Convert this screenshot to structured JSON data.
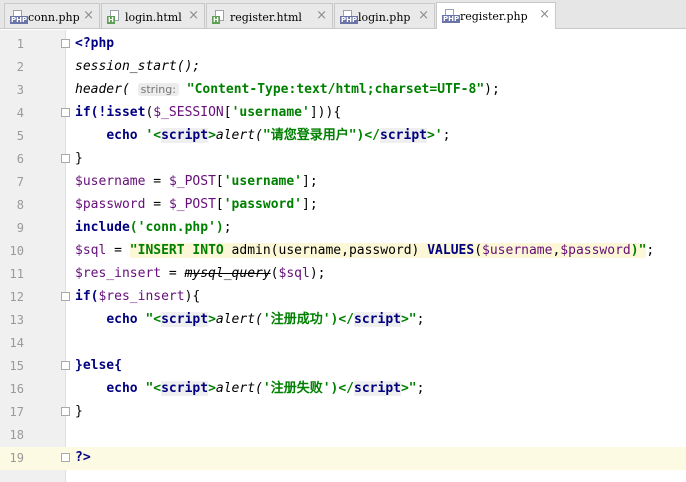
{
  "tabs": [
    {
      "label": "conn.php",
      "type": "php",
      "badge": "PHP",
      "active": false
    },
    {
      "label": "login.html",
      "type": "html",
      "badge": "H",
      "active": false
    },
    {
      "label": "register.html",
      "type": "html",
      "badge": "H",
      "active": false
    },
    {
      "label": "login.php",
      "type": "php",
      "badge": "PHP",
      "active": false
    },
    {
      "label": "register.php",
      "type": "php",
      "badge": "PHP",
      "active": true
    }
  ],
  "close_glyph": "×",
  "line_numbers": [
    "1",
    "2",
    "3",
    "4",
    "5",
    "6",
    "7",
    "8",
    "9",
    "10",
    "11",
    "12",
    "13",
    "14",
    "15",
    "16",
    "17",
    "18",
    "19"
  ],
  "code": {
    "l1": "<?php",
    "l2": "session_start();",
    "l3_fn": "header(",
    "l3_hint": "string:",
    "l3_str": "\"Content-Type:text/html;charset=UTF-8\"",
    "l3_end": ");",
    "l4_a": "if(!",
    "l4_b": "isset",
    "l4_c": "(",
    "l4_d": "$_SESSION",
    "l4_e": "[",
    "l4_f": "'username'",
    "l4_g": "])){",
    "l5_a": "echo",
    "l5_b": "'<",
    "l5_c": "script",
    "l5_d": ">",
    "l5_e": "alert(",
    "l5_f": "\"请您登录用户\"",
    "l5_g": ")</",
    "l5_h": "script",
    "l5_i": ">'",
    "l5_j": ";",
    "l6": "}",
    "l7_a": "$username",
    "l7_b": " = ",
    "l7_c": "$_POST",
    "l7_d": "[",
    "l7_e": "'username'",
    "l7_f": "];",
    "l8_a": "$password",
    "l8_b": " = ",
    "l8_c": "$_POST",
    "l8_d": "[",
    "l8_e": "'password'",
    "l8_f": "];",
    "l9_a": "include",
    "l9_b": "('conn.php')",
    "l9_c": ";",
    "l10_a": "$sql",
    "l10_b": " = ",
    "l10_c": "\"INSERT INTO",
    "l10_d": " admin(username,password) ",
    "l10_e": "VALUES",
    "l10_f": "(",
    "l10_g": "$username",
    "l10_h": ",",
    "l10_i": "$password",
    "l10_j": ")\"",
    "l10_k": ";",
    "l11_a": "$res_insert",
    "l11_b": " = ",
    "l11_c": "mysql_query",
    "l11_d": "(",
    "l11_e": "$sql",
    "l11_f": ");",
    "l12_a": "if(",
    "l12_b": "$res_insert",
    "l12_c": "){",
    "l13_a": "echo",
    "l13_b": "\"<",
    "l13_c": "script",
    "l13_d": ">",
    "l13_e": "alert(",
    "l13_f": "'注册成功'",
    "l13_g": ")</",
    "l13_h": "script",
    "l13_i": ">\"",
    "l13_j": ";",
    "l15": "}else{",
    "l16_a": "echo",
    "l16_b": "\"<",
    "l16_c": "script",
    "l16_d": ">",
    "l16_e": "alert(",
    "l16_f": "'注册失败'",
    "l16_g": ")</",
    "l16_h": "script",
    "l16_i": ">\"",
    "l16_j": ";",
    "l17": "}",
    "l19": "?>"
  }
}
